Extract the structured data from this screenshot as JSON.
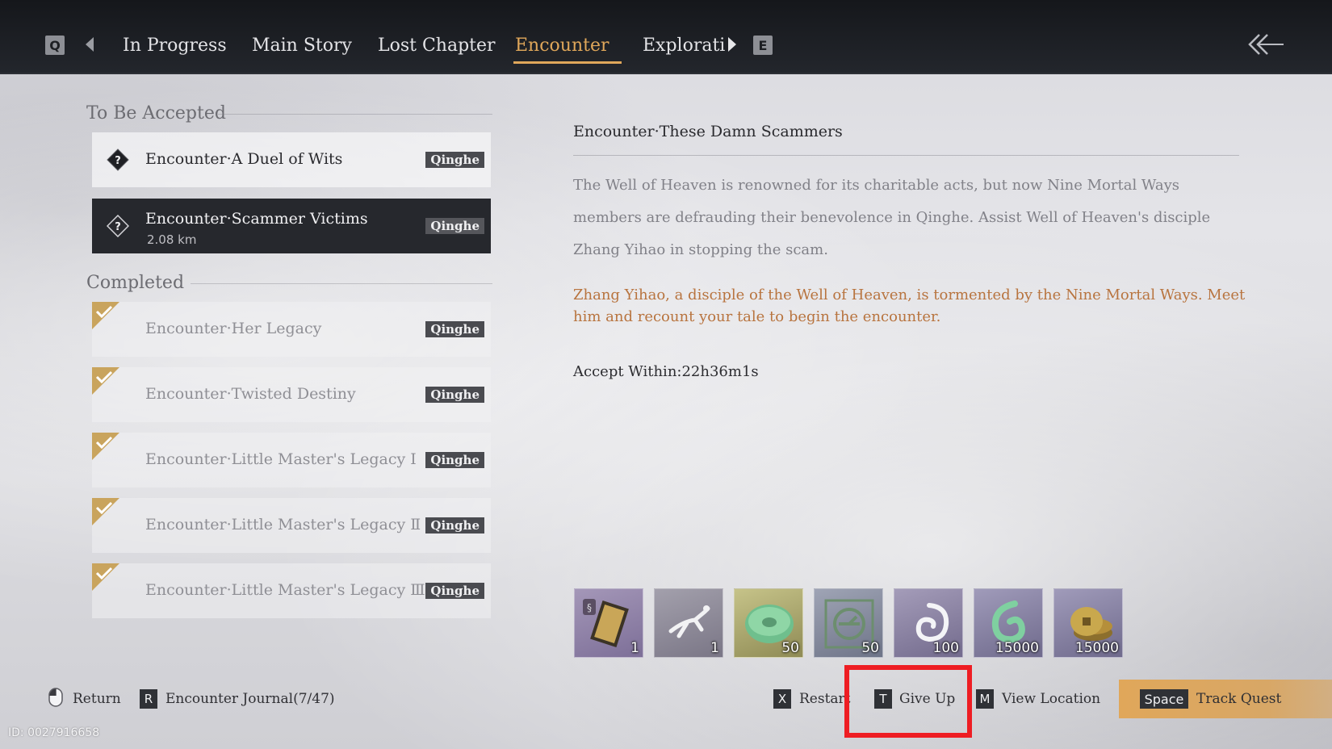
{
  "tabs": {
    "left_key": "Q",
    "right_key": "E",
    "items": [
      {
        "label": "In Progress",
        "active": false
      },
      {
        "label": "Main Story",
        "active": false
      },
      {
        "label": "Lost Chapter",
        "active": false
      },
      {
        "label": "Encounter",
        "active": true
      },
      {
        "label": "Explorati",
        "active": false
      }
    ]
  },
  "list": {
    "to_be_accepted_title": "To Be Accepted",
    "to_be_accepted": [
      {
        "name": "Encounter·A Duel of Wits",
        "region": "Qinghe",
        "selected": false
      },
      {
        "name": "Encounter·Scammer Victims",
        "region": "Qinghe",
        "distance": "2.08 km",
        "selected": true
      }
    ],
    "completed_title": "Completed",
    "completed": [
      {
        "name": "Encounter·Her Legacy",
        "region": "Qinghe"
      },
      {
        "name": "Encounter·Twisted Destiny",
        "region": "Qinghe"
      },
      {
        "name": "Encounter·Little Master's Legacy Ⅰ",
        "region": "Qinghe"
      },
      {
        "name": "Encounter·Little Master's Legacy Ⅱ",
        "region": "Qinghe"
      },
      {
        "name": "Encounter·Little Master's Legacy Ⅲ",
        "region": "Qinghe"
      }
    ]
  },
  "detail": {
    "title": "Encounter·These Damn Scammers",
    "description": "The Well of Heaven is renowned for its charitable acts, but now Nine Mortal Ways members are defrauding their benevolence in Qinghe. Assist Well of Heaven's disciple Zhang Yihao in stopping the scam.",
    "objective": "Zhang Yihao, a disciple of the Well of Heaven, is tormented by the Nine Mortal Ways. Meet him and recount your tale to begin the encounter.",
    "timer": "Accept Within:22h36m1s"
  },
  "rewards": [
    {
      "icon": "scroll-book-icon",
      "qty": "1",
      "color": "#8e7fa6"
    },
    {
      "icon": "leaping-figure-icon",
      "qty": "1",
      "color": "#8e8a98"
    },
    {
      "icon": "jade-disc-icon",
      "qty": "50",
      "color": "#a8a66a"
    },
    {
      "icon": "green-emblem-icon",
      "qty": "50",
      "color": "#8a8fa2"
    },
    {
      "icon": "swirl-icon",
      "qty": "100",
      "color": "#8f87a6"
    },
    {
      "icon": "green-swirl-icon",
      "qty": "15000",
      "color": "#8a86a4"
    },
    {
      "icon": "coins-icon",
      "qty": "15000",
      "color": "#8a86a4"
    }
  ],
  "actions": {
    "return_label": "Return",
    "journal_key": "R",
    "journal_label": "Encounter Journal(7/47)",
    "restart_key": "X",
    "restart_label": "Restart",
    "giveup_key": "T",
    "giveup_label": "Give Up",
    "location_key": "M",
    "location_label": "View Location",
    "track_key": "Space",
    "track_label": "Track Quest"
  },
  "id_text": "ID: 0027916658",
  "colors": {
    "accent": "#e0a75a",
    "objective": "#b8743f",
    "highlight": "#ee1d23"
  }
}
